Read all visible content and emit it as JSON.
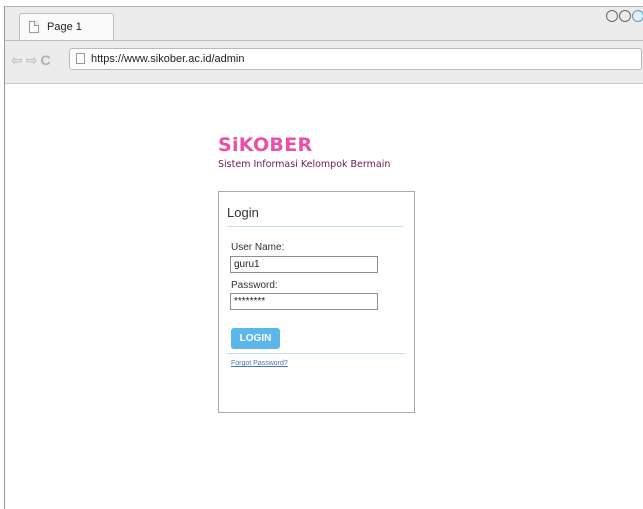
{
  "browser": {
    "tab_title": "Page 1",
    "url": "https://www.sikober.ac.id/admin",
    "nav_icons": [
      "back-arrow-icon",
      "forward-arrow-icon",
      "reload-icon"
    ]
  },
  "brand": {
    "title": "SiKOBER",
    "subtitle": "Sistem Informasi Kelompok Bermain",
    "title_color": "#ee4fa6"
  },
  "login": {
    "heading": "Login",
    "username_label": "User Name:",
    "username_value": "guru1",
    "password_label": "Password:",
    "password_value": "********",
    "button_label": "LOGIN",
    "forgot_link": "Forgot Password?",
    "button_color": "#5bb6ea"
  }
}
